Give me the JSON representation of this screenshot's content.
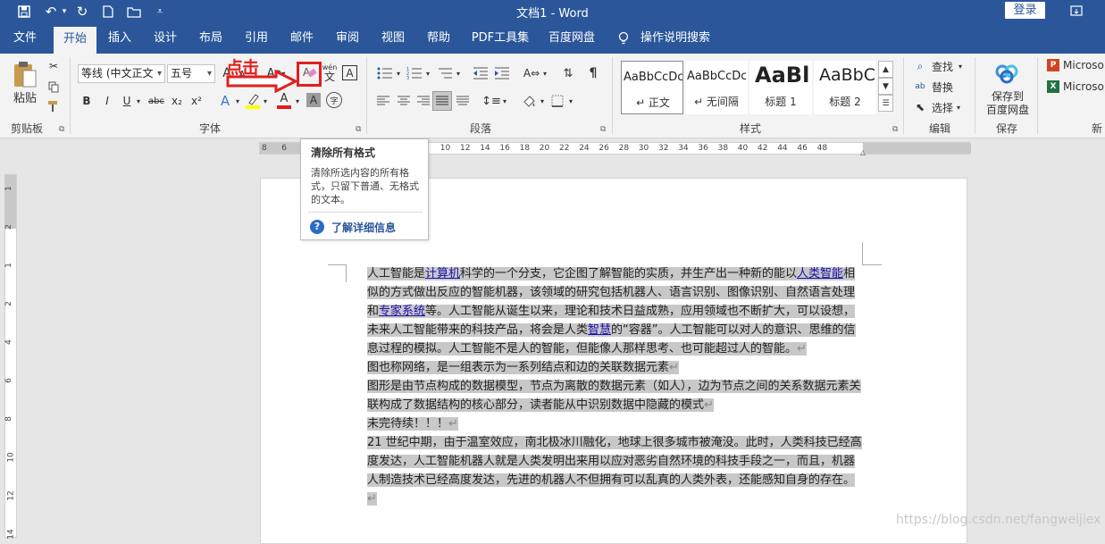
{
  "title_bar": {
    "doc_title": "文档1  -  Word",
    "login_label": "登录",
    "qa_icons": [
      "save-icon",
      "undo-icon",
      "dropdown-caret-icon",
      "redo-icon",
      "new-doc-icon",
      "open-folder-icon",
      "customize-qat-icon"
    ]
  },
  "tabs": [
    {
      "label": "文件"
    },
    {
      "label": "开始",
      "active": true
    },
    {
      "label": "插入"
    },
    {
      "label": "设计"
    },
    {
      "label": "布局"
    },
    {
      "label": "引用"
    },
    {
      "label": "邮件"
    },
    {
      "label": "审阅"
    },
    {
      "label": "视图"
    },
    {
      "label": "帮助"
    },
    {
      "label": "PDF工具集"
    },
    {
      "label": "百度网盘"
    },
    {
      "label": "操作说明搜索"
    }
  ],
  "ribbon": {
    "clipboard": {
      "paste_label": "粘贴",
      "group_label": "剪贴板"
    },
    "font": {
      "font_name": "等线 (中文正文",
      "font_size": "五号",
      "group_label": "字体",
      "grow": "A",
      "shrink": "A",
      "case": "Aa",
      "pinyin_top": "wén",
      "pinyin_char": "文",
      "border_char": "A",
      "bold": "B",
      "italic": "I",
      "underline": "U",
      "strike": "abc",
      "sub": "x₂",
      "sup": "x²",
      "effects": "A",
      "font_color": "A",
      "shading": "A",
      "enclose": "字"
    },
    "paragraph": {
      "group_label": "段落"
    },
    "styles": {
      "group_label": "样式",
      "items": [
        {
          "sample": "AaBbCcDc",
          "name": "↵ 正文"
        },
        {
          "sample": "AaBbCcDc",
          "name": "↵ 无间隔"
        },
        {
          "sample": "AaBl",
          "name": "标题 1"
        },
        {
          "sample": "AaBbC",
          "name": "标题 2"
        }
      ]
    },
    "editing": {
      "group_label": "编辑",
      "find": "查找",
      "replace": "替换",
      "select": "选择"
    },
    "save": {
      "label_line1": "保存到",
      "label_line2": "百度网盘",
      "group_label": "保存"
    },
    "microsoft": {
      "item1": "Microso",
      "item2": "Microso",
      "group_label": "新"
    }
  },
  "tooltip": {
    "title": "清除所有格式",
    "desc": "清除所选内容的所有格式，只留下普通、无格式的文本。",
    "help": "了解详细信息"
  },
  "annotation": {
    "click_label": "点击"
  },
  "ruler": {
    "h_numbers": [
      "8",
      "6",
      "4",
      "2",
      "",
      "2",
      "4",
      "6",
      "8",
      "10",
      "12",
      "14",
      "16",
      "18",
      "20",
      "22",
      "24",
      "26",
      "28",
      "30",
      "32",
      "34",
      "36",
      "38",
      "40",
      "42",
      "44",
      "46",
      "48"
    ],
    "v_numbers": [
      "1",
      "2",
      "1",
      "2",
      "4",
      "6",
      "8",
      "10",
      "12",
      "14"
    ]
  },
  "document": {
    "p1": {
      "a": "人工智能是",
      "link1": "计算机",
      "b": "科学的一个分支，它企图了解智能的实质，并生产出一种新的能以",
      "link2": "人类智能",
      "c": "相似的方式做出反应的智能机器，该领域的研究包括机器人、语言识别、图像识别、自然语言处理和",
      "link3": "专家系统",
      "d": "等。人工智能从诞生以来，理论和技术日益成熟，应用领域也不断扩大，可以设想，未来人工智能带来的科技产品，将会是人类",
      "link4": "智慧",
      "e": "的“容器”。人工智能可以对人的意识、思维的信息过程的模拟。人工智能不是人的智能，但能像人那样思考、也可能超过人的智能。"
    },
    "p2": "图也称网络，是一组表示为一系列结点和边的关联数据元素",
    "p3": "图形是由节点构成的数据模型，节点为离散的数据元素（如人），边为节点之间的关系数据元素关联构成了数据结构的核心部分，读者能从中识别数据中隐藏的模式",
    "p4": "未完待续！！！",
    "p5": "21 世纪中期，由于温室效应，南北极冰川融化，地球上很多城市被淹没。此时，人类科技已经高度发达，人工智能机器人就是人类发明出来用以应对恶劣自然环境的科技手段之一，而且，机器人制造技术已经高度发达，先进的机器人不但拥有可以乱真的人类外表，还能感知自身的存在。",
    "pilcrow": "↵"
  },
  "watermark": "https://blog.csdn.net/fangweijiex",
  "colors": {
    "title_bar": "#2b579a",
    "ribbon": "#f3f3f3",
    "annotation": "#e0201e",
    "link": "#1a0dab",
    "selection": "#c8c8c8"
  }
}
